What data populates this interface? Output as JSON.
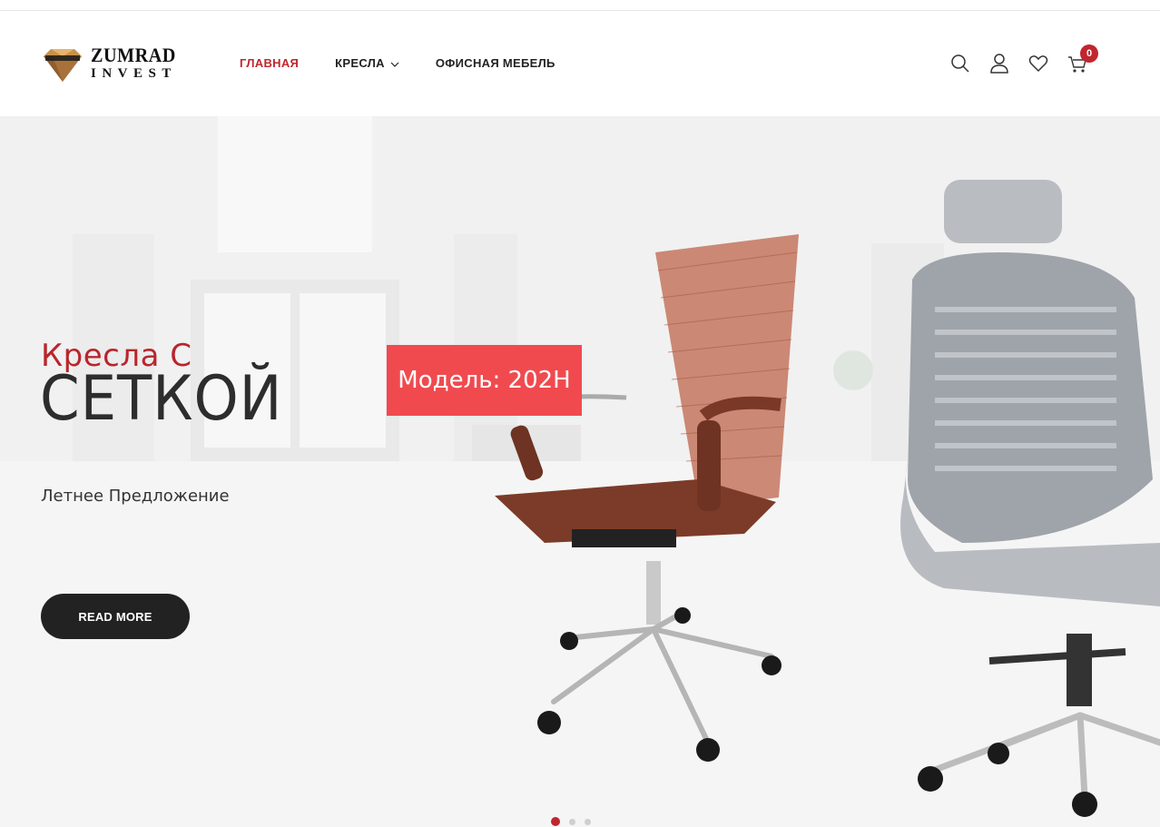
{
  "brand": {
    "line1": "ZUMRAD",
    "line2": "INVEST",
    "emblem_text": "ZUMRAD"
  },
  "nav": {
    "items": [
      {
        "label": "ГЛАВНАЯ",
        "active": true
      },
      {
        "label": "КРЕСЛА",
        "dropdown": true
      },
      {
        "label": "ОФИСНАЯ МЕБЕЛЬ"
      }
    ]
  },
  "header_icons": [
    "search-icon",
    "user-icon",
    "heart-icon",
    "cart-icon"
  ],
  "cart": {
    "count": "0"
  },
  "hero": {
    "subtitle": "Кресла С",
    "title": "СЕТКОЙ",
    "offer": "Летнее Предложение",
    "button": "READ MORE",
    "model_tag": "Модель: 202H"
  },
  "slider": {
    "slides": 3,
    "active": 1
  },
  "colors": {
    "accent": "#c0262d",
    "button": "#222222",
    "tag": "#f04a4f"
  }
}
